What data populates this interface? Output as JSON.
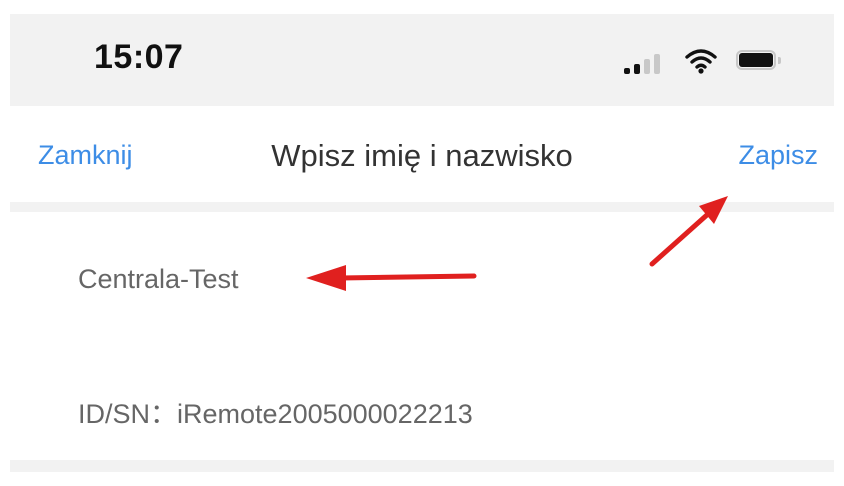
{
  "status_bar": {
    "time": "15:07",
    "icons": [
      "cellular-signal-icon",
      "wifi-icon",
      "battery-icon"
    ]
  },
  "nav": {
    "close_label": "Zamknij",
    "title": "Wpisz imię i nazwisko",
    "save_label": "Zapisz"
  },
  "form": {
    "name_value": "Centrala-Test",
    "id_label": "ID/SN：",
    "id_value": "iRemote2005000022213"
  },
  "annotations": {
    "arrow_color": "#e0201f",
    "arrows": [
      "name-field-arrow",
      "save-button-arrow"
    ]
  },
  "colors": {
    "accent": "#3d8de6",
    "status_bg": "#f2f2f2",
    "text_gray": "#666666"
  }
}
